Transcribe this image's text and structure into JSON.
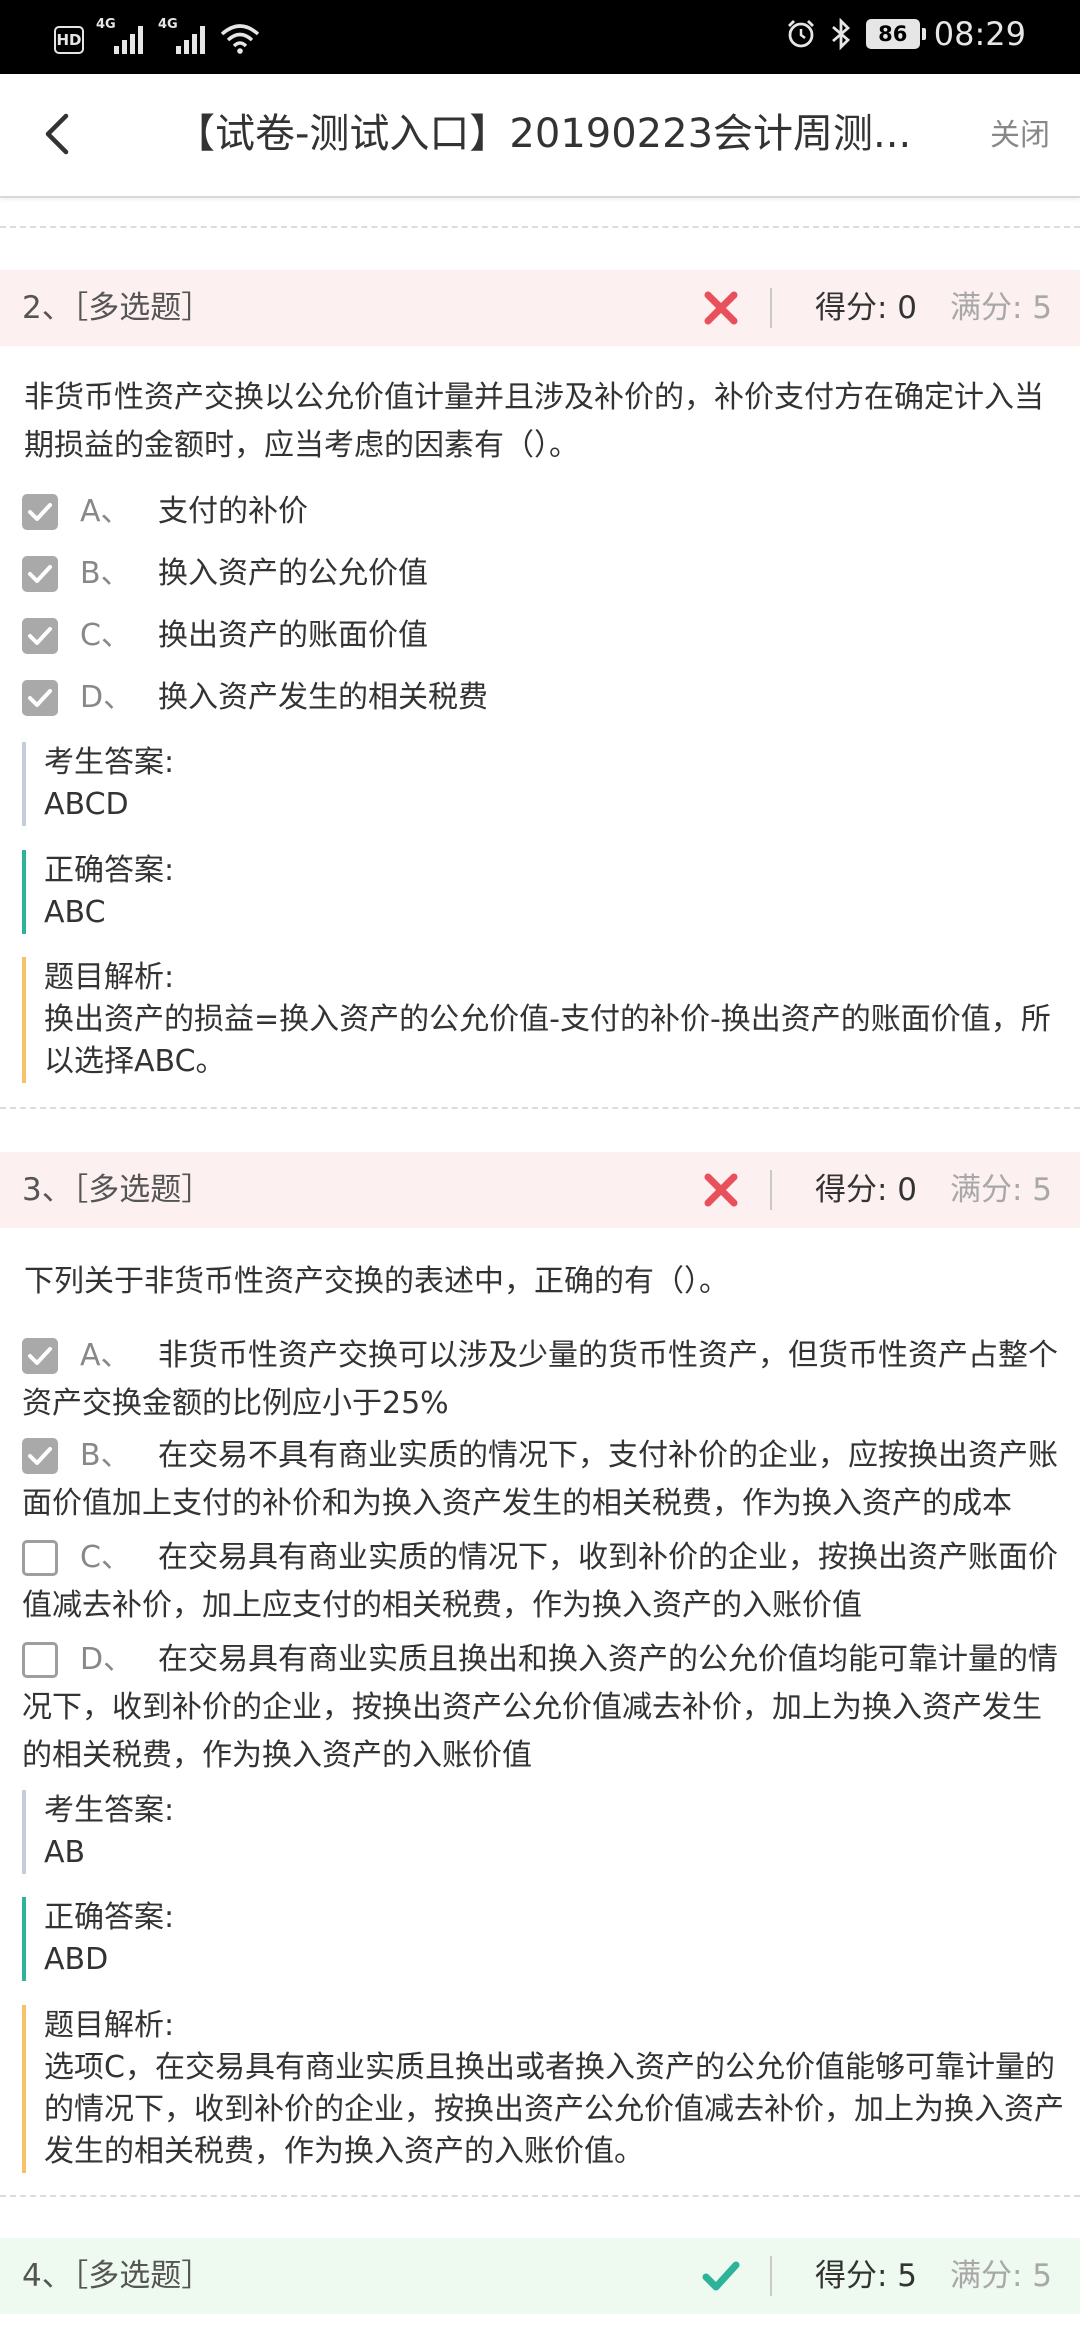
{
  "status_bar": {
    "hd": "HD",
    "net1": "4G",
    "net2": "4G",
    "battery": "86",
    "time": "08:29"
  },
  "header": {
    "title": "【试卷-测试入口】20190223会计周测...",
    "close_label": "关闭"
  },
  "questions": [
    {
      "num": "2、［多选题］",
      "result": "wrong",
      "score": "得分: 0",
      "full": "满分: 5",
      "text": "非货币性资产交换以公允价值计量并且涉及补价的，补价支付方在确定计入当期损益的金额时，应当考虑的因素有（）。",
      "options": [
        {
          "letter": "A、",
          "text": "支付的补价",
          "checked": true
        },
        {
          "letter": "B、",
          "text": "换入资产的公允价值",
          "checked": true
        },
        {
          "letter": "C、",
          "text": "换出资产的账面价值",
          "checked": true
        },
        {
          "letter": "D、",
          "text": "换入资产发生的相关税费",
          "checked": true
        }
      ],
      "exam_label": "考生答案:",
      "exam_answer": "ABCD",
      "correct_label": "正确答案:",
      "correct_answer": "ABC",
      "analysis_label": "题目解析:",
      "analysis": "换出资产的损益=换入资产的公允价值-支付的补价-换出资产的账面价值，所以选择ABC。"
    },
    {
      "num": "3、［多选题］",
      "result": "wrong",
      "score": "得分: 0",
      "full": "满分: 5",
      "text": "下列关于非货币性资产交换的表述中，正确的有（）。",
      "options": [
        {
          "letter": "A、",
          "text": "非货币性资产交换可以涉及少量的货币性资产，但货币性资产占整个资产交换金额的比例应小于25%",
          "checked": true
        },
        {
          "letter": "B、",
          "text": "在交易不具有商业实质的情况下，支付补价的企业，应按换出资产账面价值加上支付的补价和为换入资产发生的相关税费，作为换入资产的成本",
          "checked": true
        },
        {
          "letter": "C、",
          "text": "在交易具有商业实质的情况下，收到补价的企业，按换出资产账面价值减去补价，加上应支付的相关税费，作为换入资产的入账价值",
          "checked": false
        },
        {
          "letter": "D、",
          "text": "在交易具有商业实质且换出和换入资产的公允价值均能可靠计量的情况下，收到补价的企业，按换出资产公允价值减去补价，加上为换入资产发生的相关税费，作为换入资产的入账价值",
          "checked": false
        }
      ],
      "exam_label": "考生答案:",
      "exam_answer": "AB",
      "correct_label": "正确答案:",
      "correct_answer": "ABD",
      "analysis_label": "题目解析:",
      "analysis": "选项C，在交易具有商业实质且换出或者换入资产的公允价值能够可靠计量的的情况下，收到补价的企业，按换出资产公允价值减去补价，加上为换入资产发生的相关税费，作为换入资产的入账价值。"
    },
    {
      "num": "4、［多选题］",
      "result": "right",
      "score": "得分: 5",
      "full": "满分: 5"
    }
  ],
  "colors": {
    "wrong_mark": "#e8505b",
    "right_mark": "#2cb39a",
    "wrong_bg": "#fdf0f0",
    "right_bg": "#eef9ef",
    "exam_bar": "#c6ccd8",
    "correct_bar": "#2cb39a",
    "analysis_bar": "#f5c46a"
  }
}
